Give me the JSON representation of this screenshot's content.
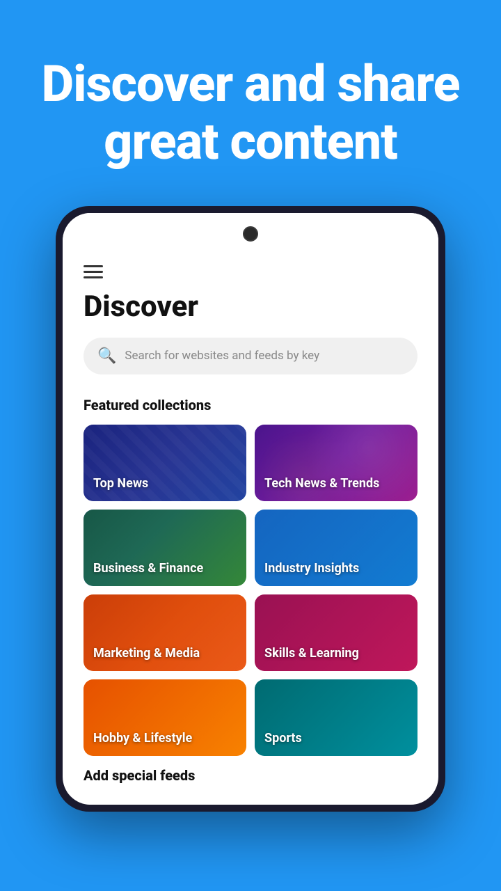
{
  "hero": {
    "title": "Discover and share great content"
  },
  "app": {
    "discover_title": "Discover",
    "search_placeholder": "Search for websites and feeds by key",
    "featured_collections_label": "Featured collections",
    "add_feeds_label": "Add special feeds",
    "collections": [
      {
        "id": "top-news",
        "label": "Top News",
        "card_class": "card-top-news"
      },
      {
        "id": "tech-news",
        "label": "Tech News & Trends",
        "card_class": "card-tech-news"
      },
      {
        "id": "business",
        "label": "Business & Finance",
        "card_class": "card-business"
      },
      {
        "id": "industry",
        "label": "Industry Insights",
        "card_class": "card-industry"
      },
      {
        "id": "marketing",
        "label": "Marketing & Media",
        "card_class": "card-marketing"
      },
      {
        "id": "skills",
        "label": "Skills & Learning",
        "card_class": "card-skills"
      },
      {
        "id": "hobby",
        "label": "Hobby & Lifestyle",
        "card_class": "card-hobby"
      },
      {
        "id": "sports",
        "label": "Sports",
        "card_class": "card-sports"
      }
    ]
  }
}
